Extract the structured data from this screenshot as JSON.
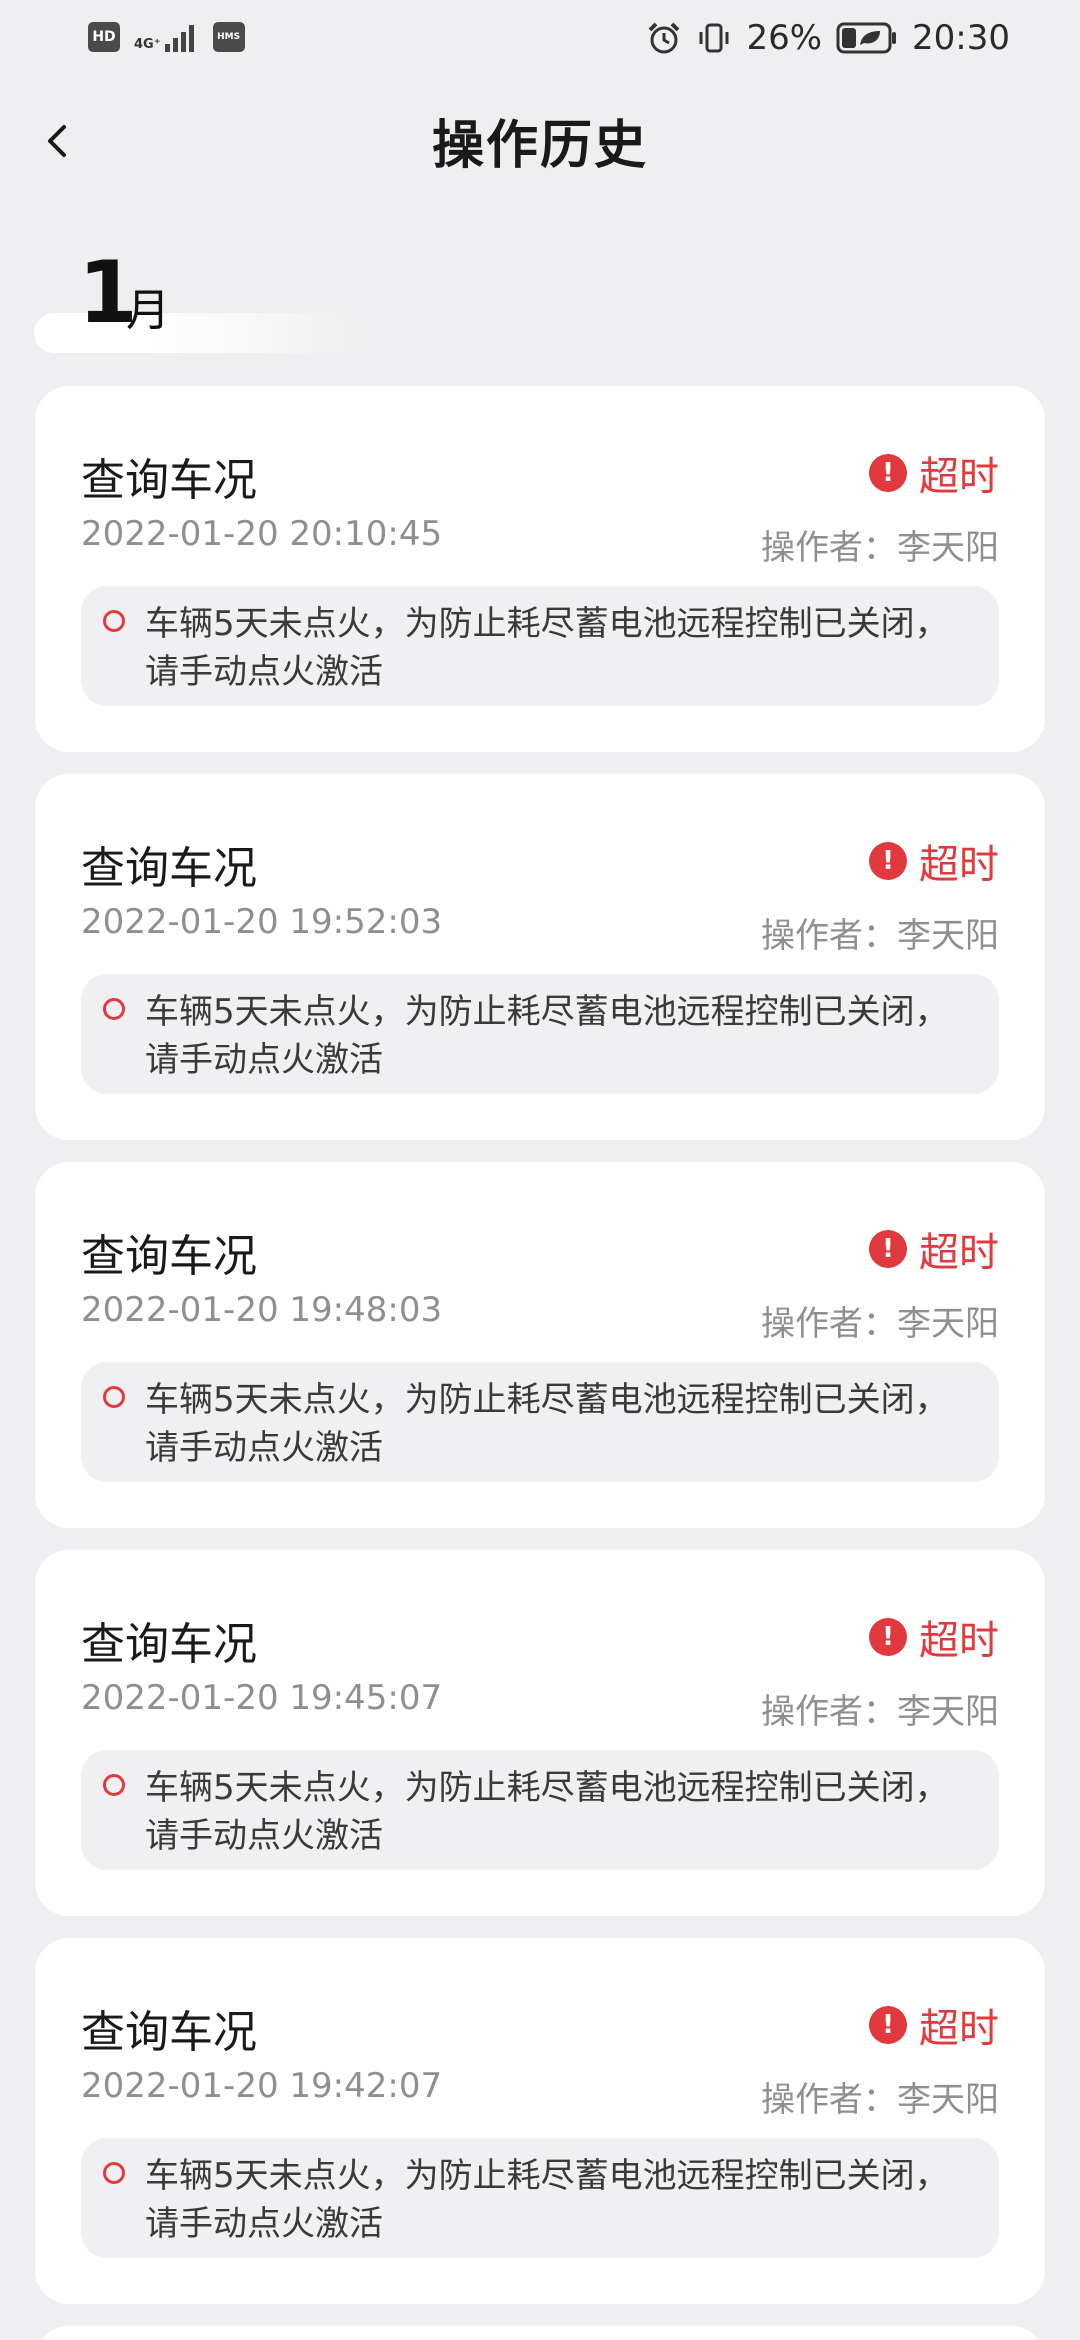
{
  "status_bar": {
    "hd": "HD",
    "network": "4G⁺",
    "hms": "HMS",
    "battery_percent": "26%",
    "time": "20:30"
  },
  "header": {
    "title": "操作历史"
  },
  "month": {
    "number": "1",
    "unit": "月"
  },
  "status_color": "#e03a3e",
  "records": [
    {
      "title": "查询车况",
      "time": "2022-01-20 20:10:45",
      "status": "超时",
      "operator": "操作者：李天阳",
      "message": "车辆5天未点火，为防止耗尽蓄电池远程控制已关闭，请手动点火激活"
    },
    {
      "title": "查询车况",
      "time": "2022-01-20 19:52:03",
      "status": "超时",
      "operator": "操作者：李天阳",
      "message": "车辆5天未点火，为防止耗尽蓄电池远程控制已关闭，请手动点火激活"
    },
    {
      "title": "查询车况",
      "time": "2022-01-20 19:48:03",
      "status": "超时",
      "operator": "操作者：李天阳",
      "message": "车辆5天未点火，为防止耗尽蓄电池远程控制已关闭，请手动点火激活"
    },
    {
      "title": "查询车况",
      "time": "2022-01-20 19:45:07",
      "status": "超时",
      "operator": "操作者：李天阳",
      "message": "车辆5天未点火，为防止耗尽蓄电池远程控制已关闭，请手动点火激活"
    },
    {
      "title": "查询车况",
      "time": "2022-01-20 19:42:07",
      "status": "超时",
      "operator": "操作者：李天阳",
      "message": "车辆5天未点火，为防止耗尽蓄电池远程控制已关闭，请手动点火激活"
    }
  ]
}
